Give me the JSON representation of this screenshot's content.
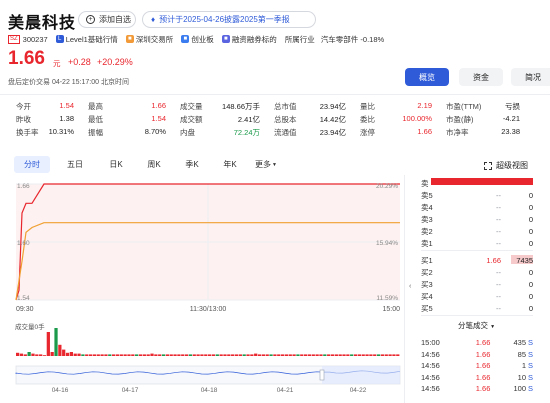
{
  "header": {
    "stock_name": "美晨科技",
    "watch_label": "添加自选",
    "notice": "预计于2025-04-26披露2025第一季报"
  },
  "tags": {
    "market_badge": "SZ",
    "code": "300237",
    "level": "Level1基础行情",
    "exchange": "深圳交易所",
    "board": "创业板",
    "margin": "融资融券标的",
    "industry_label": "所属行业",
    "industry": "汽车零部件 -0.18%"
  },
  "quote": {
    "price": "1.66",
    "unit": "元",
    "change": "+0.28",
    "change_pct": "+20.29%",
    "status": "盘后定价交易  04-22 15:17:00 北京时间"
  },
  "right_tabs": [
    "概览",
    "资金",
    "简况"
  ],
  "stats": [
    [
      [
        "今开",
        "1.54",
        "red"
      ],
      [
        "最高",
        "1.66",
        "red"
      ],
      [
        "成交量",
        "148.66万手",
        ""
      ],
      [
        "总市值",
        "23.94亿",
        ""
      ],
      [
        "量比",
        "2.19",
        "red"
      ],
      [
        "市盈(TTM)",
        "亏损",
        ""
      ]
    ],
    [
      [
        "昨收",
        "1.38",
        ""
      ],
      [
        "最低",
        "1.54",
        "red"
      ],
      [
        "成交额",
        "2.41亿",
        ""
      ],
      [
        "总股本",
        "14.42亿",
        ""
      ],
      [
        "委比",
        "100.00%",
        "red"
      ],
      [
        "市盈(静)",
        "-4.21",
        ""
      ]
    ],
    [
      [
        "换手率",
        "10.31%",
        ""
      ],
      [
        "振幅",
        "8.70%",
        ""
      ],
      [
        "内盘",
        "72.24万",
        "green"
      ],
      [
        "流通值",
        "23.94亿",
        ""
      ],
      [
        "涨停",
        "1.66",
        "red"
      ],
      [
        "市净率",
        "23.38",
        ""
      ]
    ]
  ],
  "period_tabs": [
    "分时",
    "五日",
    "日K",
    "周K",
    "季K",
    "年K",
    "更多"
  ],
  "super_view": "超级视图",
  "chart_data": {
    "type": "line",
    "series": [
      {
        "values": [
          1.54,
          1.55,
          1.63,
          1.64,
          1.64,
          1.66,
          1.66,
          1.66,
          1.66,
          1.66,
          1.66,
          1.66,
          1.66,
          1.66,
          1.66
        ]
      },
      {
        "values": [
          1.54,
          1.56,
          1.58,
          1.61,
          1.615,
          1.62,
          1.62,
          1.62,
          1.62,
          1.62,
          1.62,
          1.62,
          1.62,
          1.62,
          1.62
        ]
      }
    ],
    "y_left_ticks": [
      "1.66",
      "1.60",
      "1.54"
    ],
    "y_right_ticks": [
      "20.29%",
      "15.94%",
      "11.59%"
    ],
    "x_ticks": [
      "09:30",
      "11:30/13:00",
      "15:00"
    ],
    "ylim": [
      1.54,
      1.66
    ],
    "volume_label": "成交量0手",
    "volume_values": [
      4,
      3,
      2,
      5,
      3,
      2,
      2,
      1,
      30,
      5,
      35,
      14,
      8,
      4,
      5,
      3,
      3,
      2,
      2,
      2,
      2,
      2,
      2,
      2,
      2,
      2,
      2,
      2,
      2,
      2,
      2,
      2,
      2,
      2,
      2,
      3,
      2,
      2,
      2,
      2,
      2,
      2,
      2,
      2,
      2,
      2,
      2,
      2,
      2,
      2,
      2,
      2,
      2,
      2,
      2,
      2,
      2,
      2,
      2,
      2,
      2,
      2,
      3,
      2,
      2,
      2,
      2,
      2,
      2,
      2,
      2,
      2,
      2,
      2,
      2,
      2,
      2,
      2,
      2,
      2,
      2,
      2,
      2,
      2,
      2,
      2,
      2,
      2,
      2,
      2,
      2,
      2,
      2,
      2,
      2,
      2,
      2,
      2,
      2,
      2
    ],
    "nav_dates": [
      "04-16",
      "04-17",
      "04-18",
      "04-21",
      "04-22"
    ]
  },
  "order_book": {
    "sells": [
      [
        "卖",
        "",
        ""
      ],
      [
        "卖5",
        "--",
        "0"
      ],
      [
        "卖4",
        "--",
        "0"
      ],
      [
        "卖3",
        "--",
        "0"
      ],
      [
        "卖2",
        "--",
        "0"
      ],
      [
        "卖1",
        "--",
        "0"
      ]
    ],
    "buys": [
      [
        "买1",
        "1.66",
        "7435"
      ],
      [
        "买2",
        "--",
        "0"
      ],
      [
        "买3",
        "--",
        "0"
      ],
      [
        "买4",
        "--",
        "0"
      ],
      [
        "买5",
        "--",
        "0"
      ]
    ]
  },
  "ticks_header": "分笔成交",
  "ticks": [
    [
      "15:00",
      "1.66",
      "435",
      "S"
    ],
    [
      "14:56",
      "1.66",
      "85",
      "S"
    ],
    [
      "14:56",
      "1.66",
      "1",
      "S"
    ],
    [
      "14:56",
      "1.66",
      "10",
      "S"
    ],
    [
      "14:56",
      "1.66",
      "100",
      "S"
    ]
  ]
}
